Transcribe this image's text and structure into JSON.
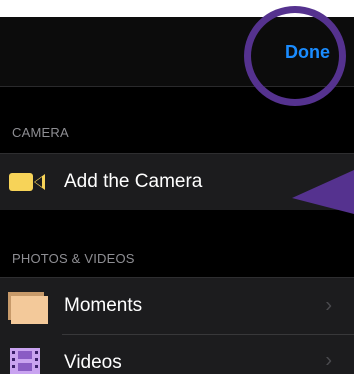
{
  "nav": {
    "done_label": "Done"
  },
  "sections": {
    "camera_header": "CAMERA",
    "photos_header": "PHOTOS & VIDEOS"
  },
  "rows": {
    "add_camera": {
      "label": "Add the Camera",
      "icon": "video-camera-icon"
    },
    "moments": {
      "label": "Moments",
      "icon": "photo-album-icon",
      "chevron": "›"
    },
    "videos": {
      "label": "Videos",
      "icon": "film-icon",
      "chevron": "›"
    }
  },
  "colors": {
    "accent_blue": "#1a8cff",
    "annotation_purple": "#55328f",
    "camera_yellow": "#f7d358",
    "moments_tan": "#f3c99a",
    "videos_purple": "#c9a3f0"
  }
}
